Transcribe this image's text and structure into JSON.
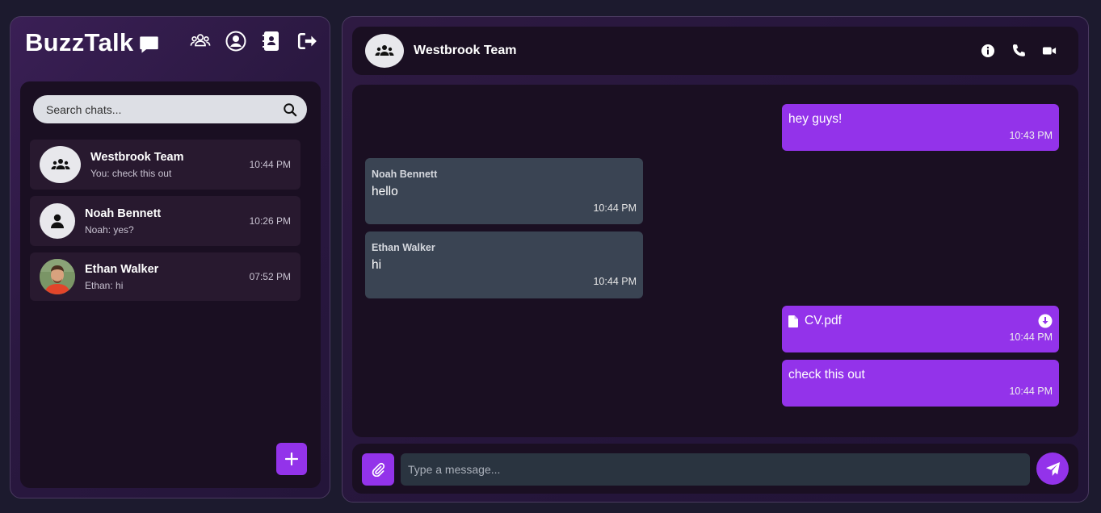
{
  "app": {
    "brand": "BuzzTalk"
  },
  "sidebar": {
    "top_icons": [
      "groups-icon",
      "user-circle-icon",
      "contacts-book-icon",
      "logout-icon"
    ],
    "search": {
      "placeholder": "Search chats..."
    },
    "chats": [
      {
        "name": "Westbrook Team",
        "last": "You: check this out",
        "time": "10:44 PM",
        "avatar": "group-icon"
      },
      {
        "name": "Noah Bennett",
        "last": "Noah: yes?",
        "time": "10:26 PM",
        "avatar": "user-icon"
      },
      {
        "name": "Ethan Walker",
        "last": "Ethan: hi",
        "time": "07:52 PM",
        "avatar": "photo"
      }
    ]
  },
  "conversation": {
    "title": "Westbrook Team",
    "header_icons": [
      "info-icon",
      "phone-icon",
      "video-icon"
    ],
    "messages": [
      {
        "direction": "out",
        "text": "hey guys!",
        "time": "10:43 PM"
      },
      {
        "direction": "in",
        "sender": "Noah Bennett",
        "text": "hello",
        "time": "10:44 PM"
      },
      {
        "direction": "in",
        "sender": "Ethan Walker",
        "text": "hi",
        "time": "10:44 PM"
      },
      {
        "direction": "out",
        "type": "file",
        "text": "CV.pdf",
        "time": "10:44 PM"
      },
      {
        "direction": "out",
        "text": "check this out",
        "time": "10:44 PM"
      }
    ],
    "composer": {
      "placeholder": "Type a message..."
    }
  },
  "colors": {
    "accent": "#9333ea",
    "panel": "#1a0f22",
    "incoming_bubble": "#3a4453",
    "background": "#1c1a2e"
  }
}
